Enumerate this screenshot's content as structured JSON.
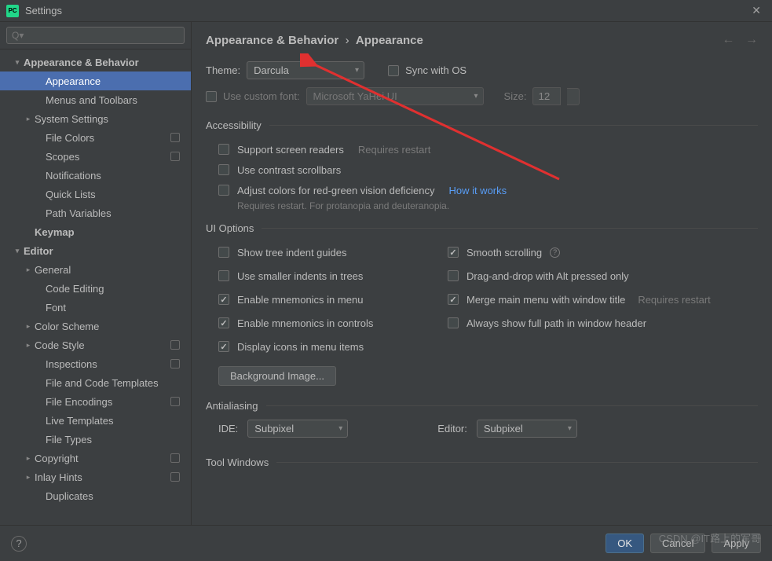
{
  "window": {
    "title": "Settings",
    "logo": "PC"
  },
  "search": {
    "placeholder": "Q▾"
  },
  "breadcrumb": {
    "parent": "Appearance & Behavior",
    "sep": "›",
    "current": "Appearance"
  },
  "sidebar": [
    {
      "label": "Appearance & Behavior",
      "bold": true,
      "arrow": "▾",
      "indent": 0
    },
    {
      "label": "Appearance",
      "selected": true,
      "indent": 2
    },
    {
      "label": "Menus and Toolbars",
      "indent": 2
    },
    {
      "label": "System Settings",
      "arrow": "▸",
      "indent": 1
    },
    {
      "label": "File Colors",
      "indent": 2,
      "badge": true
    },
    {
      "label": "Scopes",
      "indent": 2,
      "badge": true
    },
    {
      "label": "Notifications",
      "indent": 2
    },
    {
      "label": "Quick Lists",
      "indent": 2
    },
    {
      "label": "Path Variables",
      "indent": 2
    },
    {
      "label": "Keymap",
      "bold": true,
      "indent": 1
    },
    {
      "label": "Editor",
      "bold": true,
      "arrow": "▾",
      "indent": 0
    },
    {
      "label": "General",
      "arrow": "▸",
      "indent": 1
    },
    {
      "label": "Code Editing",
      "indent": 2
    },
    {
      "label": "Font",
      "indent": 2
    },
    {
      "label": "Color Scheme",
      "arrow": "▸",
      "indent": 1
    },
    {
      "label": "Code Style",
      "arrow": "▸",
      "indent": 1,
      "badge": true
    },
    {
      "label": "Inspections",
      "indent": 2,
      "badge": true
    },
    {
      "label": "File and Code Templates",
      "indent": 2
    },
    {
      "label": "File Encodings",
      "indent": 2,
      "badge": true
    },
    {
      "label": "Live Templates",
      "indent": 2
    },
    {
      "label": "File Types",
      "indent": 2
    },
    {
      "label": "Copyright",
      "arrow": "▸",
      "indent": 1,
      "badge": true
    },
    {
      "label": "Inlay Hints",
      "arrow": "▸",
      "indent": 1,
      "badge": true
    },
    {
      "label": "Duplicates",
      "indent": 2
    }
  ],
  "theme": {
    "label": "Theme:",
    "value": "Darcula",
    "sync": "Sync with OS"
  },
  "font": {
    "useCustom": "Use custom font:",
    "fontValue": "Microsoft YaHei UI",
    "sizeLabel": "Size:",
    "sizeValue": "12"
  },
  "accessibility": {
    "title": "Accessibility",
    "screenReaders": "Support screen readers",
    "requiresRestart": "Requires restart",
    "contrastScroll": "Use contrast scrollbars",
    "colorDef": "Adjust colors for red-green vision deficiency",
    "howItWorks": "How it works",
    "note": "Requires restart. For protanopia and deuteranopia."
  },
  "uiOptions": {
    "title": "UI Options",
    "left": [
      {
        "label": "Show tree indent guides",
        "checked": false
      },
      {
        "label": "Use smaller indents in trees",
        "checked": false
      },
      {
        "label": "Enable mnemonics in menu",
        "checked": true,
        "underlineChar": "m"
      },
      {
        "label": "Enable mnemonics in controls",
        "checked": true
      },
      {
        "label": "Display icons in menu items",
        "checked": true
      }
    ],
    "right": [
      {
        "label": "Smooth scrolling",
        "checked": true,
        "info": true
      },
      {
        "label": "Drag-and-drop with Alt pressed only",
        "checked": false
      },
      {
        "label": "Merge main menu with window title",
        "checked": true,
        "hint": "Requires restart"
      },
      {
        "label": "Always show full path in window header",
        "checked": false
      }
    ],
    "bgButton": "Background Image..."
  },
  "antialiasing": {
    "title": "Antialiasing",
    "ideLabel": "IDE:",
    "ideValue": "Subpixel",
    "editorLabel": "Editor:",
    "editorValue": "Subpixel"
  },
  "toolWindows": {
    "title": "Tool Windows"
  },
  "footer": {
    "ok": "OK",
    "cancel": "Cancel",
    "apply": "Apply"
  },
  "watermark": "CSDN @IT路上的军哥"
}
